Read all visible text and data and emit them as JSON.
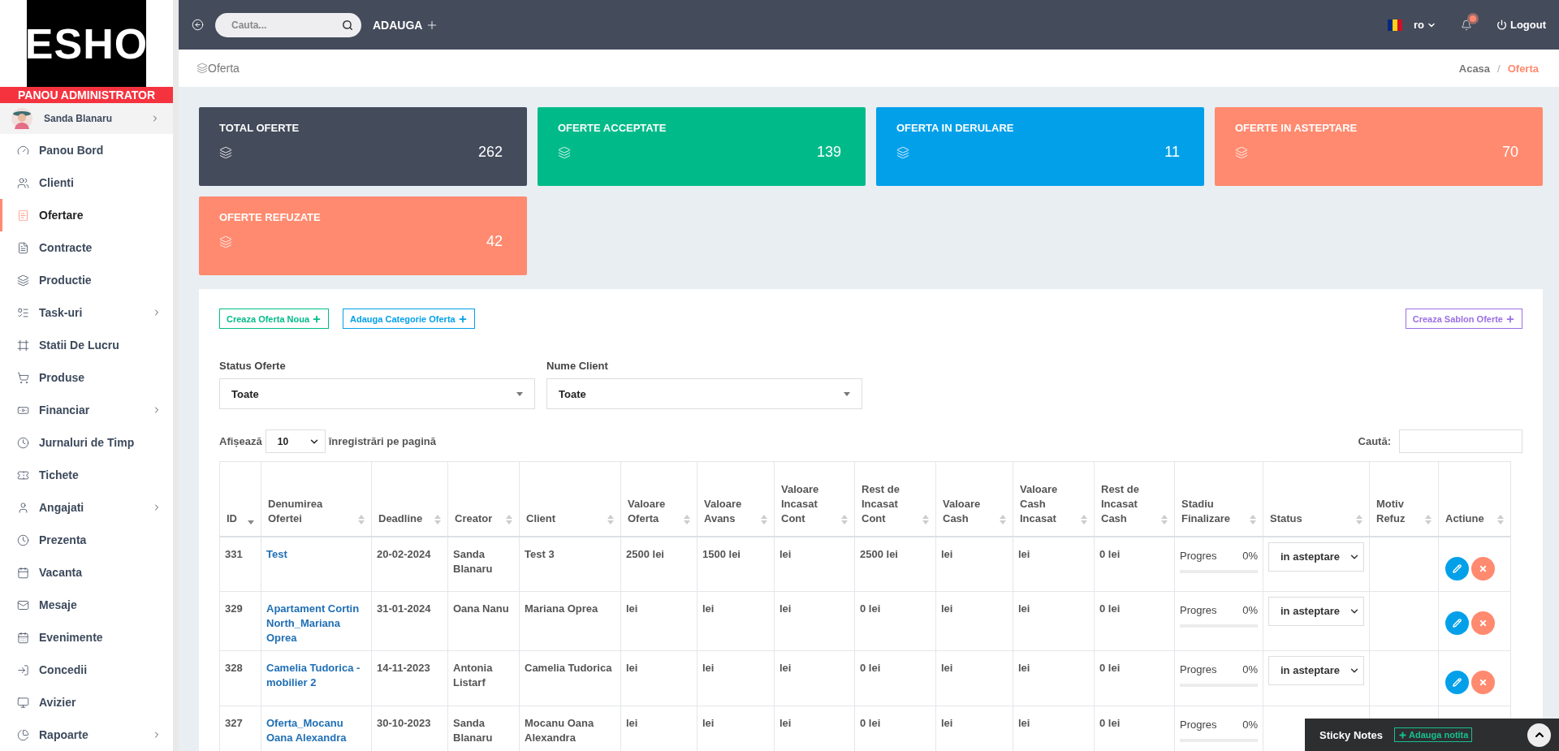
{
  "topbar": {
    "search": {
      "placeholder": "Cauta..."
    },
    "add_label": "ADAUGA",
    "language": "ro",
    "has_notifications": true,
    "logout": "Logout"
  },
  "sidebar": {
    "brand": "ESHO",
    "role": "PANOU ADMINISTRATOR",
    "user": "Sanda Blanaru",
    "items": [
      {
        "label": "Panou Bord",
        "selected": false,
        "has_children": false
      },
      {
        "label": "Clienti",
        "selected": false,
        "has_children": false
      },
      {
        "label": "Ofertare",
        "selected": true,
        "has_children": false
      },
      {
        "label": "Contracte",
        "selected": false,
        "has_children": false
      },
      {
        "label": "Productie",
        "selected": false,
        "has_children": false
      },
      {
        "label": "Task-uri",
        "selected": false,
        "has_children": true
      },
      {
        "label": "Statii De Lucru",
        "selected": false,
        "has_children": false
      },
      {
        "label": "Produse",
        "selected": false,
        "has_children": false
      },
      {
        "label": "Financiar",
        "selected": false,
        "has_children": true
      },
      {
        "label": "Jurnaluri de Timp",
        "selected": false,
        "has_children": false
      },
      {
        "label": "Tichete",
        "selected": false,
        "has_children": false
      },
      {
        "label": "Angajati",
        "selected": false,
        "has_children": true
      },
      {
        "label": "Prezenta",
        "selected": false,
        "has_children": false
      },
      {
        "label": "Vacanta",
        "selected": false,
        "has_children": false
      },
      {
        "label": "Mesaje",
        "selected": false,
        "has_children": false
      },
      {
        "label": "Evenimente",
        "selected": false,
        "has_children": false
      },
      {
        "label": "Concedii",
        "selected": false,
        "has_children": false
      },
      {
        "label": "Avizier",
        "selected": false,
        "has_children": false
      },
      {
        "label": "Rapoarte",
        "selected": false,
        "has_children": true
      }
    ]
  },
  "page_header": {
    "title": "Oferta",
    "separator": "/",
    "breadcrumb": [
      {
        "label": "Acasa",
        "selected": false
      },
      {
        "label": "Oferta",
        "selected": true
      }
    ]
  },
  "stats": [
    {
      "title": "TOTAL OFERTE",
      "value": "262",
      "color": "#444b5b"
    },
    {
      "title": "OFERTE ACCEPTATE",
      "value": "139",
      "color": "#00bb89"
    },
    {
      "title": "OFERTA IN DERULARE",
      "value": "11",
      "color": "#03a0ea"
    },
    {
      "title": "OFERTE IN ASTEPTARE",
      "value": "70",
      "color": "#ff8a6f"
    },
    {
      "title": "OFERTE REFUZATE",
      "value": "42",
      "color": "#ff8a6f"
    }
  ],
  "actions": [
    {
      "label": "Creaza Oferta Noua",
      "color": "#00bb89"
    },
    {
      "label": "Adauga Categorie Oferta",
      "color": "#03a0ea"
    },
    {
      "label": "Creaza Sablon Oferte",
      "color": "#9b6ee6"
    }
  ],
  "filters": [
    {
      "label": "Status Oferte",
      "value": "Toate"
    },
    {
      "label": "Nume Client",
      "value": "Toate"
    }
  ],
  "page_length": {
    "prefix": "Afișează",
    "value": "10",
    "suffix": "înregistrări pe pagină"
  },
  "search": {
    "label": "Caută:"
  },
  "table": {
    "columns": [
      {
        "label": "ID",
        "sorted": true
      },
      {
        "label": "Denumirea Ofertei",
        "sorted": false
      },
      {
        "label": "Deadline",
        "sorted": false
      },
      {
        "label": "Creator",
        "sorted": false
      },
      {
        "label": "Client",
        "sorted": false
      },
      {
        "label": "Valoare Oferta",
        "sorted": false
      },
      {
        "label": "Valoare Avans",
        "sorted": false
      },
      {
        "label": "Valoare Incasat Cont",
        "sorted": false
      },
      {
        "label": "Rest de Incasat Cont",
        "sorted": false
      },
      {
        "label": "Valoare Cash",
        "sorted": false
      },
      {
        "label": "Valoare Cash Incasat",
        "sorted": false
      },
      {
        "label": "Rest de Incasat Cash",
        "sorted": false
      },
      {
        "label": "Stadiu Finalizare",
        "sorted": false
      },
      {
        "label": "Status",
        "sorted": false
      },
      {
        "label": "Motiv Refuz",
        "sorted": false
      },
      {
        "label": "Actiune",
        "sorted": false
      }
    ],
    "rows": [
      {
        "cells": [
          "331",
          "Test",
          "20-02-2024",
          "Sanda Blanaru",
          "Test 3",
          "2500 lei",
          "1500 lei",
          "lei",
          "2500 lei",
          "lei",
          "lei",
          "0 lei"
        ],
        "progress": {
          "label": "Progres",
          "reading": "0%",
          "level": 0
        },
        "status": "in asteptare"
      },
      {
        "cells": [
          "329",
          "Apartament Cortin North_Mariana Oprea",
          "31-01-2024",
          "Oana Nanu",
          "Mariana Oprea",
          "lei",
          "lei",
          "lei",
          "0 lei",
          "lei",
          "lei",
          "0 lei"
        ],
        "progress": {
          "label": "Progres",
          "reading": "0%",
          "level": 0
        },
        "status": "in asteptare"
      },
      {
        "cells": [
          "328",
          "Camelia Tudorica - mobilier 2",
          "14-11-2023",
          "Antonia Listarf",
          "Camelia Tudorica",
          "lei",
          "lei",
          "lei",
          "0 lei",
          "lei",
          "lei",
          "0 lei"
        ],
        "progress": {
          "label": "Progres",
          "reading": "0%",
          "level": 0
        },
        "status": "in asteptare"
      },
      {
        "cells": [
          "327",
          "Oferta_Mocanu Oana Alexandra",
          "30-10-2023",
          "Sanda Blanaru",
          "Mocanu Oana Alexandra",
          "lei",
          "lei",
          "lei",
          "0 lei",
          "lei",
          "lei",
          "0 lei"
        ],
        "progress": {
          "label": "Progres",
          "reading": "0%",
          "level": 0
        }
      }
    ]
  },
  "sticky_notes": {
    "title": "Sticky Notes",
    "add_label": "Adauga notita"
  }
}
